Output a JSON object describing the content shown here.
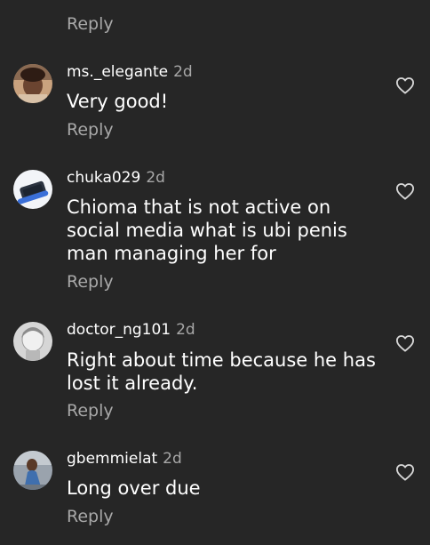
{
  "top_reply_label": "Reply",
  "comments": [
    {
      "username": "ms._elegante",
      "time": "2d",
      "text": "Very good!",
      "reply_label": "Reply",
      "avatar_icon": "profile-photo"
    },
    {
      "username": "chuka029",
      "time": "2d",
      "text": "Chioma that is not active on social media what is ubi penis man managing her for",
      "reply_label": "Reply",
      "avatar_icon": "profile-photo"
    },
    {
      "username": "doctor_ng101",
      "time": "2d",
      "text": "Right about time because he has lost it already.",
      "reply_label": "Reply",
      "avatar_icon": "profile-photo"
    },
    {
      "username": "gbemmielat",
      "time": "2d",
      "text": "Long over due",
      "reply_label": "Reply",
      "avatar_icon": "profile-photo"
    }
  ],
  "icons": {
    "like": "heart-outline-icon"
  },
  "colors": {
    "background": "#262626",
    "primary_text": "#ffffff",
    "secondary_text": "#a8a8a8"
  }
}
